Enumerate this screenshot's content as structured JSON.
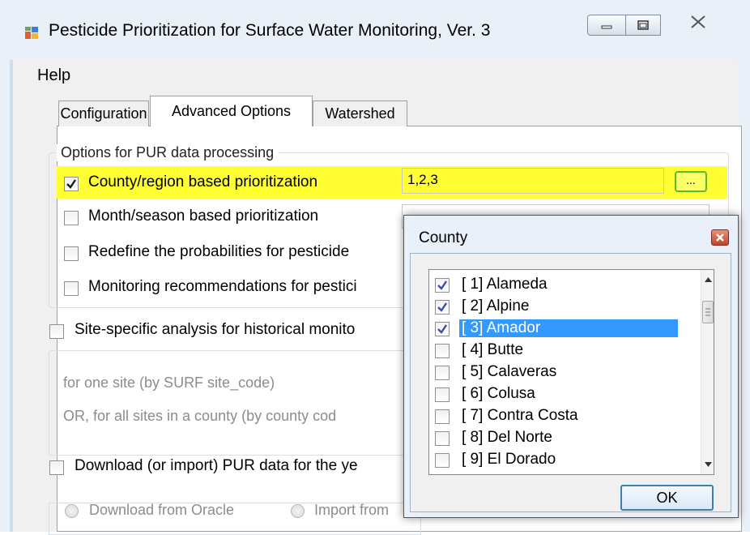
{
  "window": {
    "title": "Pesticide Prioritization for Surface Water Monitoring, Ver. 3",
    "controls": {
      "minimize": "minimize-icon",
      "maximize": "maximize-icon",
      "close": "close-icon"
    }
  },
  "menu": {
    "help": "Help"
  },
  "tabs": [
    {
      "label": "Configuration",
      "active": false
    },
    {
      "label": "Advanced Options",
      "active": true
    },
    {
      "label": "Watershed",
      "active": false
    }
  ],
  "pur_group": {
    "title": "Options for PUR data processing",
    "county": {
      "label": "County/region based prioritization",
      "checked": true,
      "value": "1,2,3",
      "browse_label": "..."
    },
    "month": {
      "label": "Month/season based prioritization",
      "checked": false
    },
    "redefine": {
      "label": "Redefine the probabilities for pesticide",
      "checked": false
    },
    "monitoring": {
      "label": "Monitoring recommendations for pestici",
      "checked": false
    }
  },
  "site": {
    "label": "Site-specific analysis for historical monito",
    "checked": false,
    "one_site": "for one site (by SURF site_code)",
    "all_sites": "OR, for all sites in a county (by county cod"
  },
  "download": {
    "label": "Download (or import) PUR data for the ye",
    "checked": false,
    "oracle": "Download from Oracle",
    "import": "Import from"
  },
  "dialog": {
    "title": "County",
    "ok_label": "OK",
    "items": [
      {
        "label": "[ 1] Alameda",
        "checked": true,
        "selected": false
      },
      {
        "label": "[ 2] Alpine",
        "checked": true,
        "selected": false
      },
      {
        "label": "[ 3] Amador",
        "checked": true,
        "selected": true
      },
      {
        "label": "[ 4] Butte",
        "checked": false,
        "selected": false
      },
      {
        "label": "[ 5] Calaveras",
        "checked": false,
        "selected": false
      },
      {
        "label": "[ 6] Colusa",
        "checked": false,
        "selected": false
      },
      {
        "label": "[ 7] Contra Costa",
        "checked": false,
        "selected": false
      },
      {
        "label": "[ 8] Del Norte",
        "checked": false,
        "selected": false
      },
      {
        "label": "[ 9] El Dorado",
        "checked": false,
        "selected": false
      }
    ]
  },
  "colors": {
    "highlight": "#ffff33",
    "selection": "#3399ff",
    "accent": "#5cba32"
  }
}
